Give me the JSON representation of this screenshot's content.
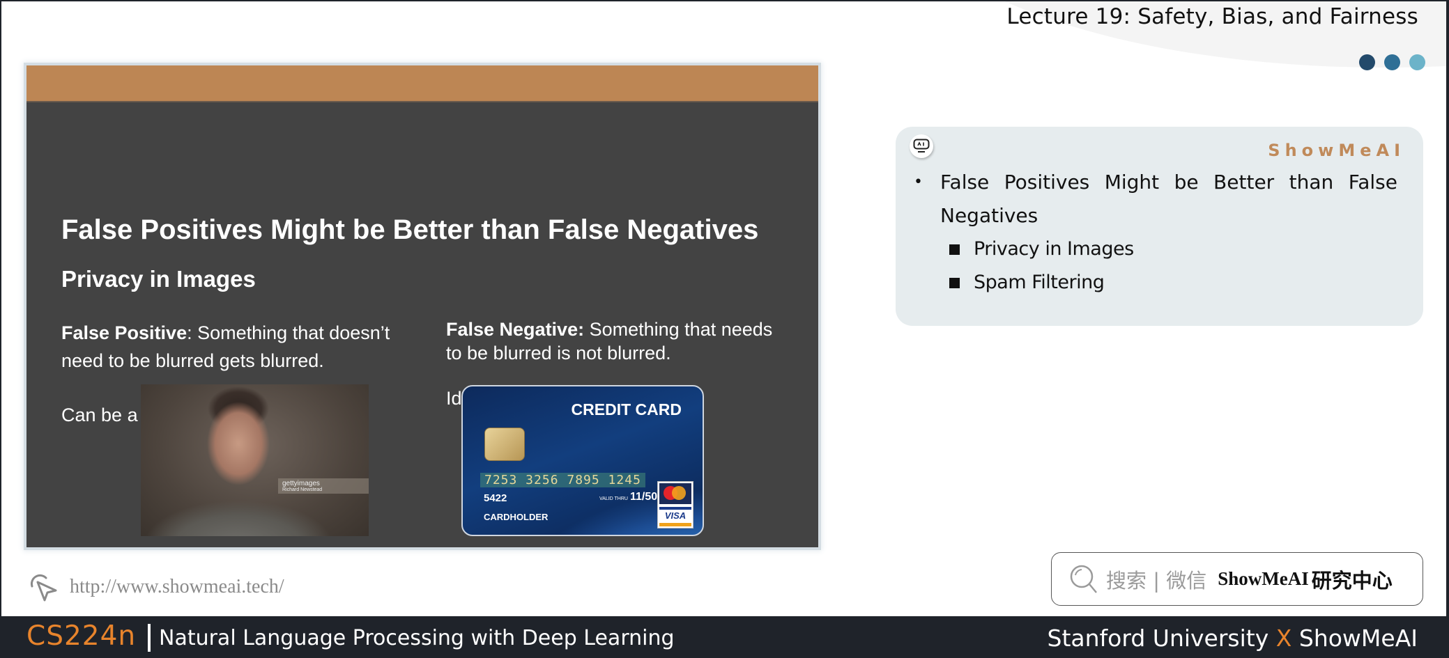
{
  "header": {
    "lecture_title": "Lecture 19: Safety, Bias, and Fairness",
    "dot_colors": [
      "#234a6b",
      "#2f6f96",
      "#6cb3c9"
    ]
  },
  "slide": {
    "band_color": "#bd8654",
    "title": "False Positives Might be Better than False Negatives",
    "subtitle": "Privacy in Images",
    "left": {
      "term": "False Positive",
      "colon": ":",
      "definition": " Something that doesn’t need to be blurred gets blurred.",
      "note": "Can be a bummer."
    },
    "right": {
      "term": "False Negative:",
      "definition": " Something that needs to be blurred is not blurred.",
      "note": "Identity theft."
    },
    "photo": {
      "watermark": "gettyimages",
      "credit": "Richard Newstead"
    },
    "credit_card": {
      "title": "CREDIT CARD",
      "number": "7253 3256 7895 1245",
      "short_number": "5422",
      "valid_label": "VALID THRU",
      "expiry": "11/50",
      "holder": "CARDHOLDER",
      "brand_mastercard": "MasterCard",
      "brand_visa": "VISA"
    }
  },
  "panel": {
    "brand": "ShowMeAI",
    "icon": "ai-robot-icon",
    "bullet": "False Positives Might be Better than False Negatives",
    "sub_bullets": [
      "Privacy in Images",
      "Spam Filtering"
    ]
  },
  "bottom": {
    "url": "http://www.showmeai.tech/",
    "search_hint": "搜索 | 微信",
    "search_brand": "ShowMeAI",
    "search_brand_cn": "研究中心"
  },
  "footer": {
    "course_code": "CS224n",
    "course_name": "Natural Language Processing with Deep Learning",
    "partner_left": "Stanford University",
    "partner_x": "X",
    "partner_right": "ShowMeAI",
    "accent_color": "#e8842c"
  }
}
